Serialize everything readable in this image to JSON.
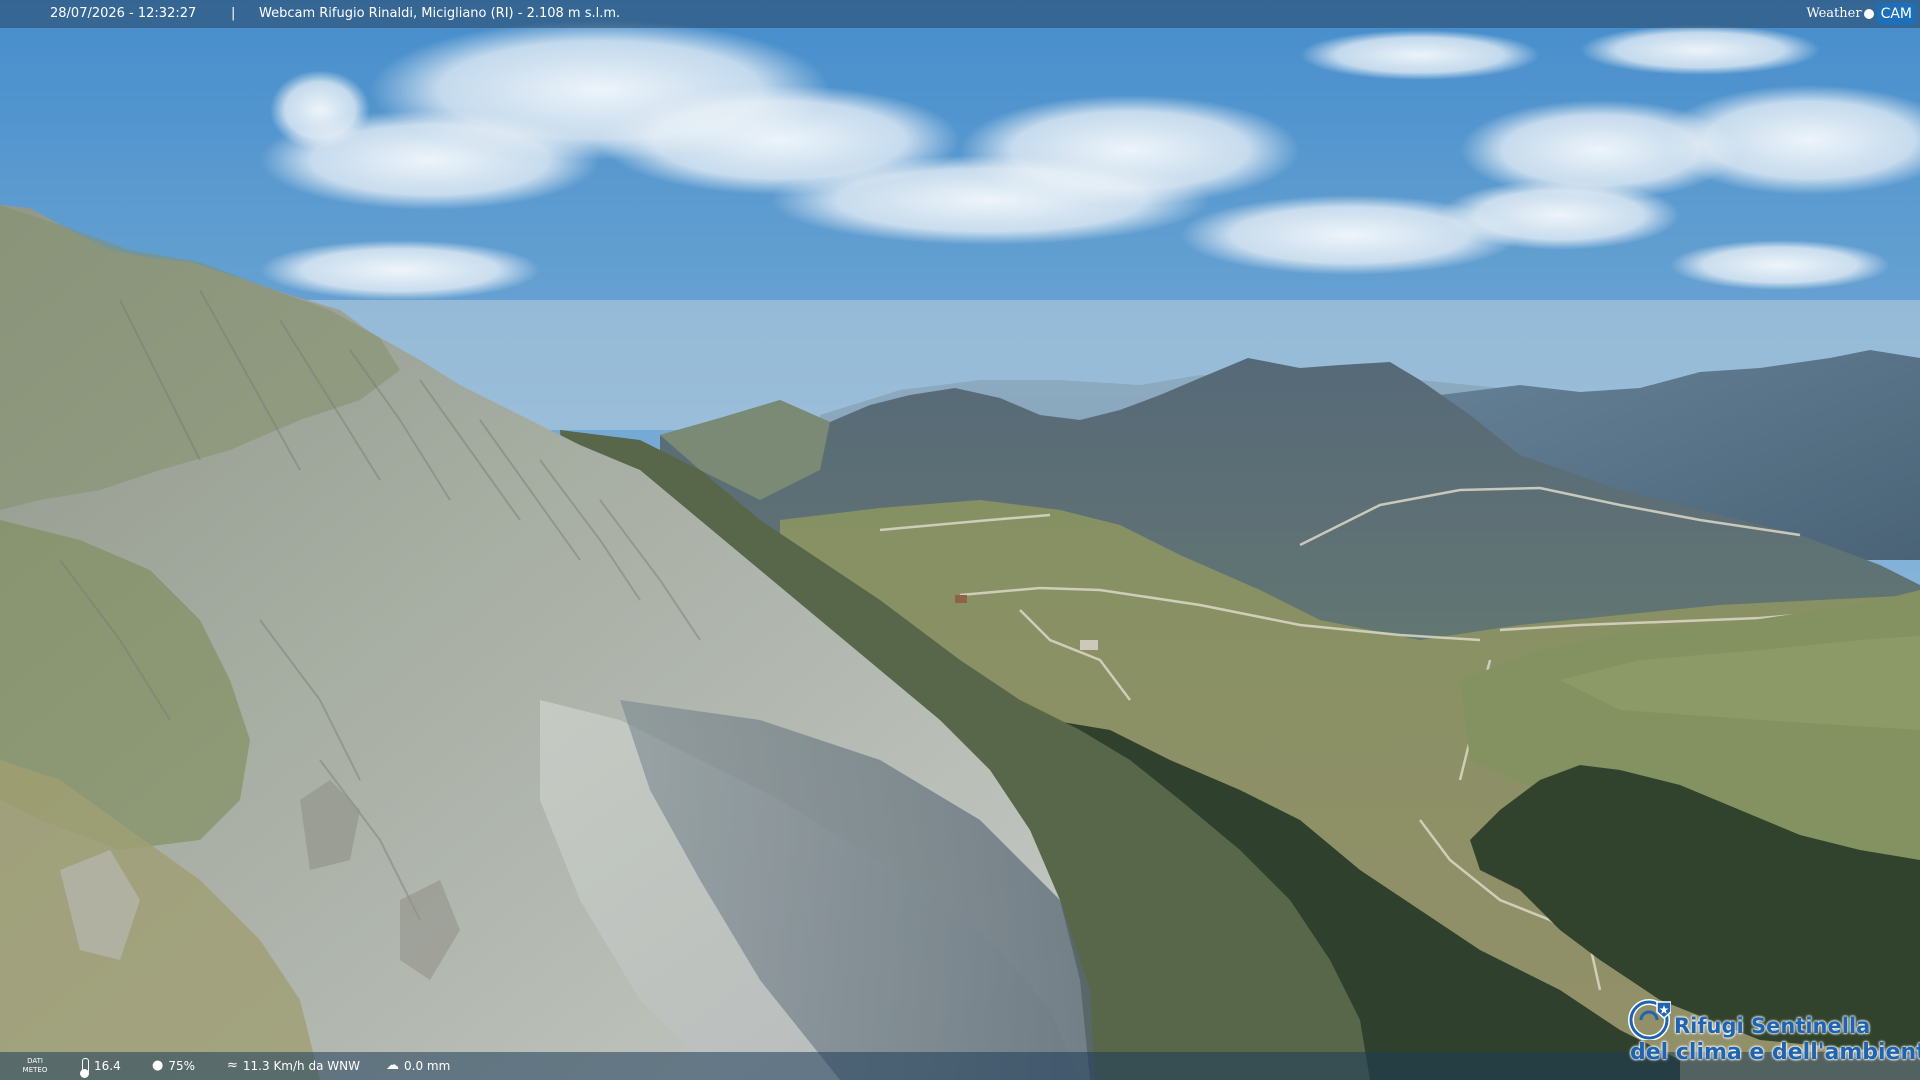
{
  "overlay": {
    "timestamp": "28/07/2026 - 12:32:27",
    "separator": "|",
    "title": "Webcam Rifugio Rinaldi, Micigliano (RI) - 2.108 m s.l.m.",
    "brand_weather": "Weather",
    "brand_cam": "CAM"
  },
  "weather": {
    "label_line1": "DATI",
    "label_line2": "METEO",
    "temperature": "16.4",
    "humidity": "75%",
    "wind": "11.3 Km/h da WNW",
    "rain": "0.0 mm",
    "icons": {
      "temperature": "thermometer-icon",
      "humidity": "drop-icon",
      "wind": "wind-icon",
      "rain": "rain-icon"
    }
  },
  "logo": {
    "line1": "Rifugi Sentinella",
    "line2": "del clima e dell'ambiente",
    "color": "#1f64b0"
  },
  "colors": {
    "sky_top": "#3b87c9",
    "sky_horizon": "#a9c4d8",
    "rock": "#9aa39a",
    "grass": "#6e7d45",
    "forest": "#263a22"
  }
}
